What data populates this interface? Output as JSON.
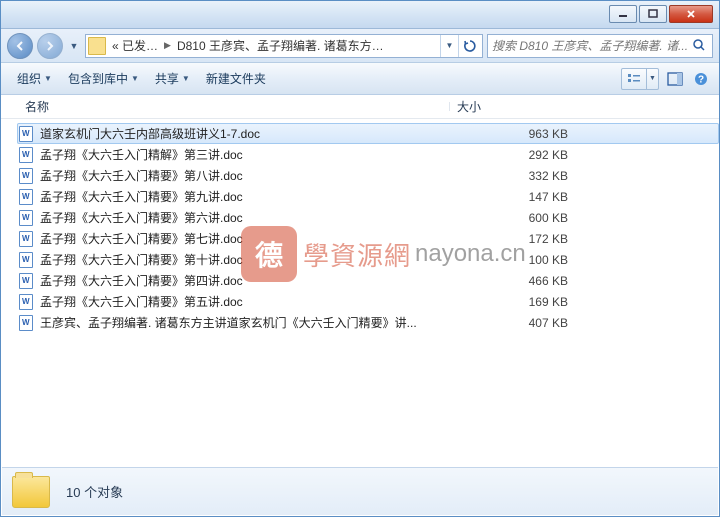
{
  "window": {
    "min_title": "Minimize",
    "max_title": "Maximize",
    "close_title": "Close"
  },
  "nav": {
    "crumb_root": "« 已发…",
    "crumb_folder": "D810 王彦宾、孟子翔编著. 诸葛东方…",
    "search_placeholder": "搜索 D810 王彦宾、孟子翔编著. 诸..."
  },
  "toolbar": {
    "organize": "组织",
    "include": "包含到库中",
    "share": "共享",
    "new_folder": "新建文件夹"
  },
  "columns": {
    "name": "名称",
    "size": "大小"
  },
  "files": [
    {
      "name": "道家玄机门大六壬内部高级班讲义1-7.doc",
      "size": "963 KB",
      "selected": true
    },
    {
      "name": "孟子翔《大六壬入门精解》第三讲.doc",
      "size": "292 KB",
      "selected": false
    },
    {
      "name": "孟子翔《大六壬入门精要》第八讲.doc",
      "size": "332 KB",
      "selected": false
    },
    {
      "name": "孟子翔《大六壬入门精要》第九讲.doc",
      "size": "147 KB",
      "selected": false
    },
    {
      "name": "孟子翔《大六壬入门精要》第六讲.doc",
      "size": "600 KB",
      "selected": false
    },
    {
      "name": "孟子翔《大六壬入门精要》第七讲.doc",
      "size": "172 KB",
      "selected": false
    },
    {
      "name": "孟子翔《大六壬入门精要》第十讲.doc",
      "size": "100 KB",
      "selected": false
    },
    {
      "name": "孟子翔《大六壬入门精要》第四讲.doc",
      "size": "466 KB",
      "selected": false
    },
    {
      "name": "孟子翔《大六壬入门精要》第五讲.doc",
      "size": "169 KB",
      "selected": false
    },
    {
      "name": "王彦宾、孟子翔编著. 诸葛东方主讲道家玄机门《大六壬入门精要》讲...",
      "size": "407 KB",
      "selected": false
    }
  ],
  "status": {
    "count_text": "10 个对象"
  },
  "watermark": {
    "brand1": "學資源網",
    "brand2": "nayona.cn"
  }
}
